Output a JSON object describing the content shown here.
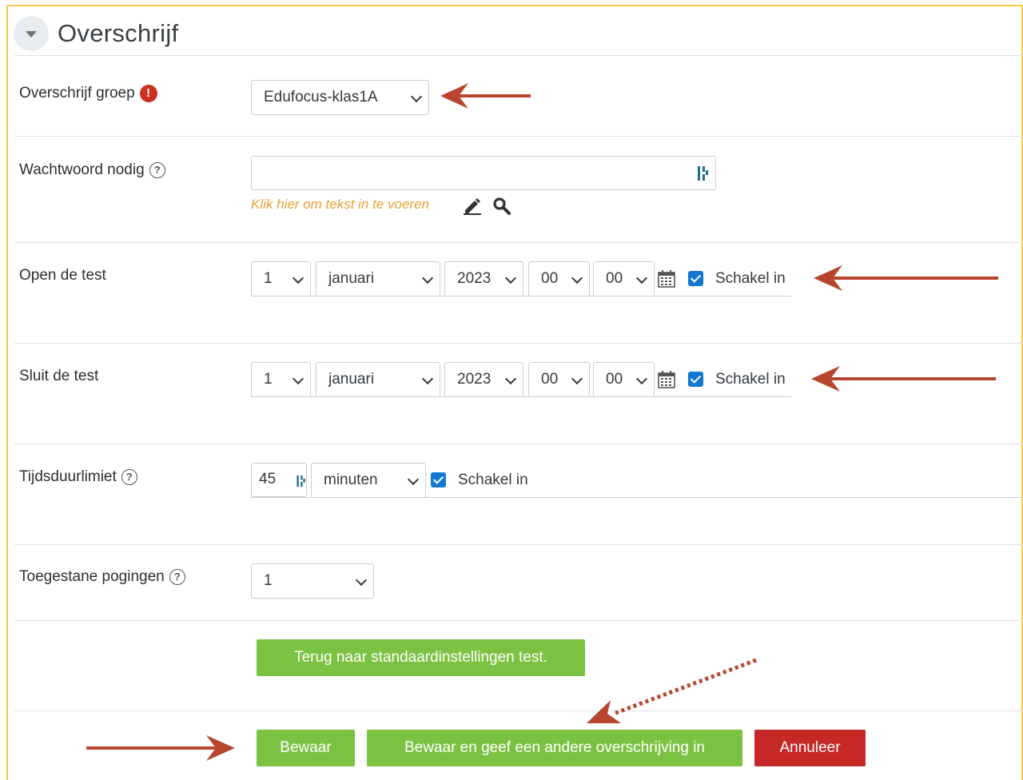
{
  "section": {
    "title": "Overschrijf"
  },
  "group": {
    "label": "Overschrijf groep",
    "value": "Edufocus-klas1A"
  },
  "password": {
    "label": "Wachtwoord nodig",
    "value": "",
    "hint": "Klik hier om tekst in te voeren"
  },
  "open": {
    "label": "Open de test",
    "day": "1",
    "month": "januari",
    "year": "2023",
    "hour": "00",
    "minute": "00",
    "enabled": true,
    "enable_label": "Schakel in"
  },
  "close": {
    "label": "Sluit de test",
    "day": "1",
    "month": "januari",
    "year": "2023",
    "hour": "00",
    "minute": "00",
    "enabled": true,
    "enable_label": "Schakel in"
  },
  "timelimit": {
    "label": "Tijdsduurlimiet",
    "value": "45",
    "unit": "minuten",
    "enabled": true,
    "enable_label": "Schakel in"
  },
  "attempts": {
    "label": "Toegestane pogingen",
    "value": "1"
  },
  "buttons": {
    "reset": "Terug naar standaardinstellingen test.",
    "save": "Bewaar",
    "save_another": "Bewaar en geef een andere overschrijving in",
    "cancel": "Annuleer"
  },
  "colors": {
    "green": "#7cc242",
    "red": "#c62828",
    "annotation_arrow": "#b8462f",
    "hint_orange": "#e8a132",
    "checkbox_blue": "#1177d1",
    "frame_yellow": "#f2c94c"
  }
}
